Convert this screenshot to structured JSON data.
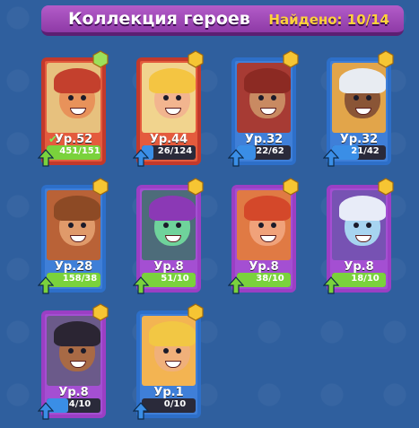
{
  "header": {
    "title": "Коллекция героев",
    "found_label": "Найдено: 10/14"
  },
  "colors": {
    "green": "#7ad23c",
    "blue": "#3a8ee6",
    "purple": "#b14fd0",
    "red": "#c2392b"
  },
  "heroes": [
    {
      "level": "Ур.52",
      "progress": "451/151",
      "fill": 1.0,
      "arrow": "green",
      "rarity": "red",
      "hex": "green",
      "skin": "#e8925a",
      "hair": "#c4402d",
      "bg": "#e7c17e",
      "check": true
    },
    {
      "level": "Ур.44",
      "progress": "26/124",
      "fill": 0.21,
      "arrow": "blue",
      "rarity": "red",
      "hex": "yellow",
      "skin": "#f2b58f",
      "hair": "#f4c542",
      "bg": "#f1d48e",
      "check": false
    },
    {
      "level": "Ур.32",
      "progress": "22/62",
      "fill": 0.35,
      "arrow": "blue",
      "rarity": "blue",
      "hex": "yellow",
      "skin": "#c98a62",
      "hair": "#8c2a23",
      "bg": "#a73b34",
      "check": false
    },
    {
      "level": "Ур.32",
      "progress": "21/42",
      "fill": 0.5,
      "arrow": "blue",
      "rarity": "blue",
      "hex": "yellow",
      "skin": "#8a5536",
      "hair": "#e8ecf2",
      "bg": "#e2a54a",
      "check": false
    },
    {
      "level": "Ур.28",
      "progress": "158/38",
      "fill": 1.0,
      "arrow": "green",
      "rarity": "blue",
      "hex": "yellow",
      "skin": "#e09a6a",
      "hair": "#8d4a25",
      "bg": "#b96237",
      "check": false
    },
    {
      "level": "Ур.8",
      "progress": "51/10",
      "fill": 1.0,
      "arrow": "green",
      "rarity": "purple",
      "hex": "yellow",
      "skin": "#6fd39b",
      "hair": "#8b39b5",
      "bg": "#4d6c7a",
      "check": false
    },
    {
      "level": "Ур.8",
      "progress": "38/10",
      "fill": 1.0,
      "arrow": "green",
      "rarity": "purple",
      "hex": "yellow",
      "skin": "#f0a27a",
      "hair": "#d4482a",
      "bg": "#e07a44",
      "check": false
    },
    {
      "level": "Ур.8",
      "progress": "18/10",
      "fill": 1.0,
      "arrow": "green",
      "rarity": "purple",
      "hex": "yellow",
      "skin": "#a7d4f0",
      "hair": "#e8ecf8",
      "bg": "#7752b3",
      "check": false
    },
    {
      "level": "Ур.8",
      "progress": "4/10",
      "fill": 0.4,
      "arrow": "blue",
      "rarity": "purple",
      "hex": "yellow",
      "skin": "#a86a45",
      "hair": "#2b2533",
      "bg": "#6b5a8a",
      "check": false
    },
    {
      "level": "Ур.1",
      "progress": "0/10",
      "fill": 0.0,
      "arrow": "blue",
      "rarity": "blue",
      "hex": "yellow",
      "skin": "#f0b07a",
      "hair": "#f2c744",
      "bg": "#f3b452",
      "check": false
    }
  ]
}
